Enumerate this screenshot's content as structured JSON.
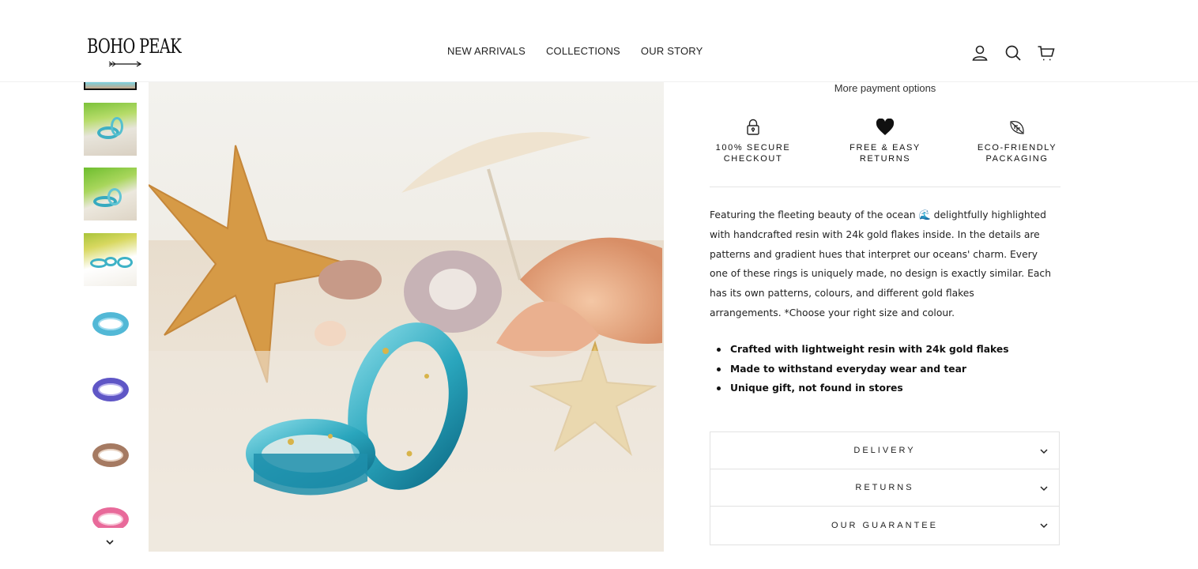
{
  "brand": {
    "name": "BOHO PEAK"
  },
  "nav": {
    "items": [
      "NEW ARRIVALS",
      "COLLECTIONS",
      "OUR STORY"
    ]
  },
  "header_icons": [
    "account-icon",
    "search-icon",
    "cart-icon"
  ],
  "gallery": {
    "thumbnails": [
      "scene-green-1",
      "scene-green-2",
      "scene-yellow-flowers",
      "ring-blue",
      "ring-purple",
      "ring-brown",
      "ring-pink"
    ],
    "scroll_down_icon": "chevron-down-icon"
  },
  "purchase": {
    "more_payment_options": "More payment options"
  },
  "badges": [
    {
      "icon": "lock-icon",
      "line1": "100% SECURE",
      "line2": "CHECKOUT"
    },
    {
      "icon": "heart-icon",
      "line1": "FREE & EASY",
      "line2": "RETURNS"
    },
    {
      "icon": "leaf-icon",
      "line1": "ECO-FRIENDLY",
      "line2": "PACKAGING"
    }
  ],
  "description": {
    "line1": "Featuring the fleeting beauty of the ocean 🌊 delightfully highlighted",
    "line2": "with handcrafted resin with 24k gold flakes inside. In the details are",
    "line3": "patterns and gradient hues that interpret our oceans' charm. Every",
    "line4": "one of these rings is uniquely made, no design is exactly similar. Each",
    "line5": "has its own patterns, colours, and different gold flakes",
    "line6": "arrangements. *Choose your right size and colour."
  },
  "features": [
    "Crafted with lightweight resin with 24k gold flakes",
    "Made to withstand everyday wear and tear",
    "Unique gift, not found in stores"
  ],
  "accordion": [
    {
      "label": "DELIVERY"
    },
    {
      "label": "RETURNS"
    },
    {
      "label": "OUR GUARANTEE"
    }
  ],
  "colors": {
    "text": "#1c1d1d",
    "border": "#e2e2e2",
    "sand": "#e7dccd",
    "resin_blue": "#38b2c8"
  }
}
